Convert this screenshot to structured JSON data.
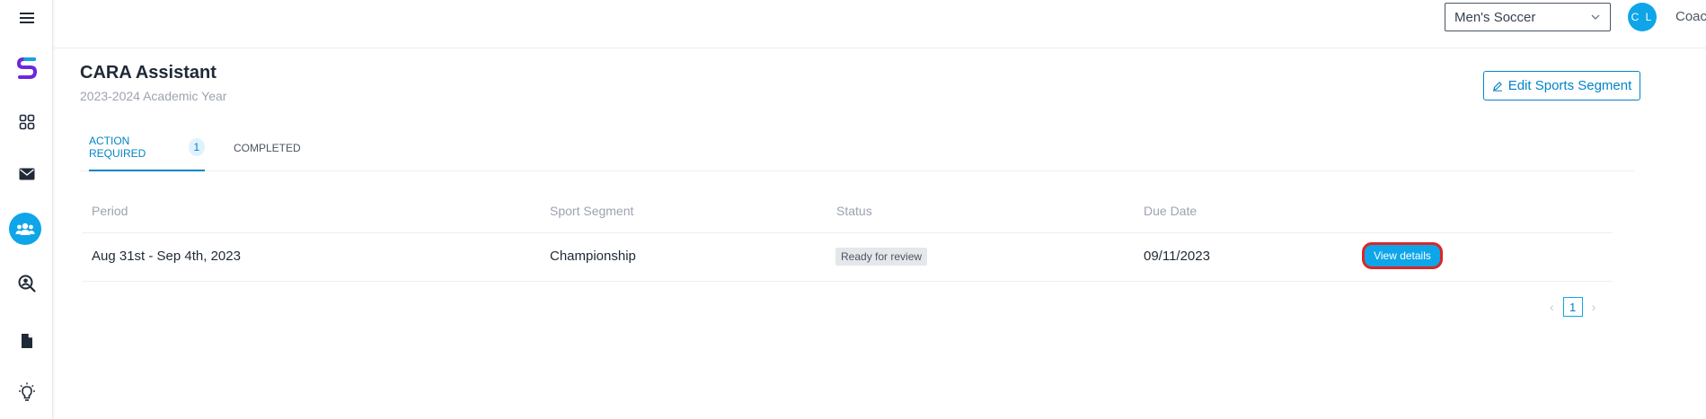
{
  "sidebar": {
    "icons": [
      "menu-icon",
      "logo-icon",
      "dashboard-icon",
      "mail-icon",
      "team-icon",
      "search-person-icon",
      "document-icon",
      "lightbulb-icon"
    ],
    "active_color": "#0ea5e9"
  },
  "topbar": {
    "sport_select": "Men's Soccer",
    "avatar_initials": "C L",
    "username": "Coach Lasso"
  },
  "header": {
    "title": "CARA Assistant",
    "subtitle": "2023-2024 Academic Year",
    "edit_button": "Edit Sports Segment"
  },
  "tabs": [
    {
      "label": "ACTION REQUIRED",
      "count": "1",
      "active": true
    },
    {
      "label": "COMPLETED",
      "active": false
    }
  ],
  "table": {
    "columns": [
      "Period",
      "Sport Segment",
      "Status",
      "Due Date"
    ],
    "rows": [
      {
        "period": "Aug 31st - Sep 4th, 2023",
        "segment": "Championship",
        "status": "Ready for review",
        "due_date": "09/11/2023",
        "action": "View details"
      }
    ]
  },
  "pagination": {
    "current_page": "1"
  },
  "colors": {
    "accent": "#0ea5e9",
    "highlight_border": "#dc2626"
  }
}
